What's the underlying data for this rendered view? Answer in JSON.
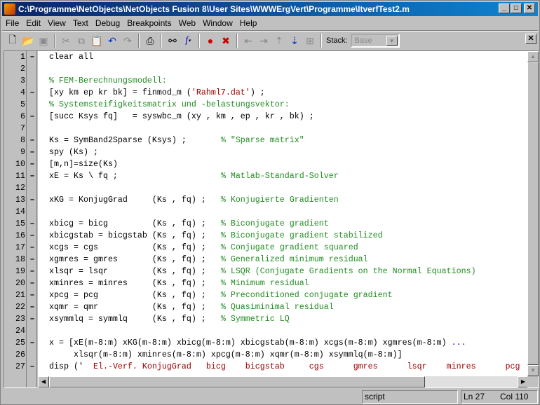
{
  "window": {
    "title": "C:\\Programme\\NetObjects\\NetObjects Fusion 8\\User Sites\\WWWErgVert\\Programme\\ItverfTest2.m"
  },
  "menu": [
    "File",
    "Edit",
    "View",
    "Text",
    "Debug",
    "Breakpoints",
    "Web",
    "Window",
    "Help"
  ],
  "toolbar": {
    "stack_label": "Stack:",
    "stack_value": "Base",
    "icons": [
      "new-file",
      "open-folder",
      "save",
      "cut",
      "copy",
      "paste",
      "undo",
      "redo",
      "print",
      "find-binoculars",
      "function-f",
      "set-breakpoint",
      "clear-breakpoint",
      "step",
      "step-in",
      "step-out",
      "continue",
      "exit-debug"
    ]
  },
  "editor": {
    "lines": [
      {
        "n": "1",
        "dash": true,
        "seg": [
          [
            "clear all",
            ""
          ]
        ]
      },
      {
        "n": "2",
        "dash": false,
        "seg": []
      },
      {
        "n": "3",
        "dash": false,
        "seg": [
          [
            "% FEM-Berechnungsmodell:",
            "comment"
          ]
        ]
      },
      {
        "n": "4",
        "dash": true,
        "seg": [
          [
            "[xy km ep kr bk] = finmod_m (",
            ""
          ],
          [
            "'Rahml7.dat'",
            "string"
          ],
          [
            ") ;",
            ""
          ]
        ]
      },
      {
        "n": "5",
        "dash": false,
        "seg": [
          [
            "% Systemsteifigkeitsmatrix und -belastungsvektor:",
            "comment"
          ]
        ]
      },
      {
        "n": "6",
        "dash": true,
        "seg": [
          [
            "[succ Ksys fq]   = syswbc_m (xy , km , ep , kr , bk) ;",
            ""
          ]
        ]
      },
      {
        "n": "7",
        "dash": false,
        "seg": []
      },
      {
        "n": "8",
        "dash": true,
        "seg": [
          [
            "Ks = SymBand2Sparse (Ksys) ;       ",
            ""
          ],
          [
            "% \"Sparse matrix\"",
            "comment"
          ]
        ]
      },
      {
        "n": "9",
        "dash": true,
        "seg": [
          [
            "spy (Ks) ;",
            ""
          ]
        ]
      },
      {
        "n": "10",
        "dash": true,
        "seg": [
          [
            "[m,n]=size(Ks)",
            ""
          ]
        ]
      },
      {
        "n": "11",
        "dash": true,
        "seg": [
          [
            "xE = Ks \\ fq ;                     ",
            ""
          ],
          [
            "% Matlab-Standard-Solver",
            "comment"
          ]
        ]
      },
      {
        "n": "12",
        "dash": false,
        "seg": []
      },
      {
        "n": "13",
        "dash": true,
        "seg": [
          [
            "xKG = KonjugGrad     (Ks , fq) ;   ",
            ""
          ],
          [
            "% Konjugierte Gradienten",
            "comment"
          ]
        ]
      },
      {
        "n": "14",
        "dash": false,
        "seg": []
      },
      {
        "n": "15",
        "dash": true,
        "seg": [
          [
            "xbicg = bicg         (Ks , fq) ;   ",
            ""
          ],
          [
            "% Biconjugate gradient",
            "comment"
          ]
        ]
      },
      {
        "n": "16",
        "dash": true,
        "seg": [
          [
            "xbicgstab = bicgstab (Ks , fq) ;   ",
            ""
          ],
          [
            "% Biconjugate gradient stabilized",
            "comment"
          ]
        ]
      },
      {
        "n": "17",
        "dash": true,
        "seg": [
          [
            "xcgs = cgs           (Ks , fq) ;   ",
            ""
          ],
          [
            "% Conjugate gradient squared",
            "comment"
          ]
        ]
      },
      {
        "n": "18",
        "dash": true,
        "seg": [
          [
            "xgmres = gmres       (Ks , fq) ;   ",
            ""
          ],
          [
            "% Generalized minimum residual",
            "comment"
          ]
        ]
      },
      {
        "n": "19",
        "dash": true,
        "seg": [
          [
            "xlsqr = lsqr         (Ks , fq) ;   ",
            ""
          ],
          [
            "% LSQR (Conjugate Gradients on the Normal Equations)",
            "comment"
          ]
        ]
      },
      {
        "n": "20",
        "dash": true,
        "seg": [
          [
            "xminres = minres     (Ks , fq) ;   ",
            ""
          ],
          [
            "% Minimum residual",
            "comment"
          ]
        ]
      },
      {
        "n": "21",
        "dash": true,
        "seg": [
          [
            "xpcg = pcg           (Ks , fq) ;   ",
            ""
          ],
          [
            "% Preconditioned conjugate gradient",
            "comment"
          ]
        ]
      },
      {
        "n": "22",
        "dash": true,
        "seg": [
          [
            "xqmr = qmr           (Ks , fq) ;   ",
            ""
          ],
          [
            "% Quasiminimal residual",
            "comment"
          ]
        ]
      },
      {
        "n": "23",
        "dash": true,
        "seg": [
          [
            "xsymmlq = symmlq     (Ks , fq) ;   ",
            ""
          ],
          [
            "% Symmetric LQ",
            "comment"
          ]
        ]
      },
      {
        "n": "24",
        "dash": false,
        "seg": []
      },
      {
        "n": "25",
        "dash": true,
        "seg": [
          [
            "x = [xE(m-8:m) xKG(m-8:m) xbicg(m-8:m) xbicgstab(m-8:m) xcgs(m-8:m) xgmres(m-8:m) ",
            ""
          ],
          [
            "...",
            "kw"
          ]
        ]
      },
      {
        "n": "26",
        "dash": false,
        "seg": [
          [
            "     xlsqr(m-8:m) xminres(m-8:m) xpcg(m-8:m) xqmr(m-8:m) xsymmlq(m-8:m)]",
            ""
          ]
        ]
      },
      {
        "n": "27",
        "dash": true,
        "seg": [
          [
            "disp ('",
            ""
          ],
          [
            "  El.-Verf. KonjugGrad   bicg    bicgstab     cgs      gmres      lsqr    minres      pcg",
            "string"
          ]
        ]
      }
    ]
  },
  "status": {
    "mode": "script",
    "line": "Ln 27",
    "col": "Col 110"
  }
}
